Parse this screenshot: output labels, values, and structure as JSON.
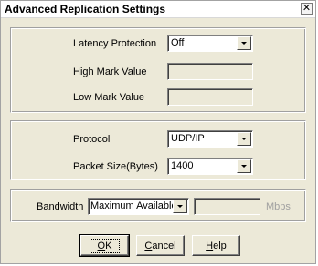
{
  "dialog": {
    "title": "Advanced Replication Settings",
    "close_glyph": "✕"
  },
  "latency": {
    "latency_protection_label": "Latency Protection",
    "latency_protection_value": "Off",
    "high_mark_label": "High Mark Value",
    "high_mark_value": "",
    "low_mark_label": "Low Mark Value",
    "low_mark_value": ""
  },
  "transport": {
    "protocol_label": "Protocol",
    "protocol_value": "UDP/IP",
    "packet_size_label": "Packet Size(Bytes)",
    "packet_size_value": "1400"
  },
  "bandwidth": {
    "label": "Bandwidth",
    "mode_value": "Maximum Available",
    "limit_value": "",
    "units": "Mbps"
  },
  "buttons": {
    "ok_access": "O",
    "ok_rest": "K",
    "cancel_access": "C",
    "cancel_rest": "ancel",
    "help_access": "H",
    "help_rest": "elp"
  }
}
